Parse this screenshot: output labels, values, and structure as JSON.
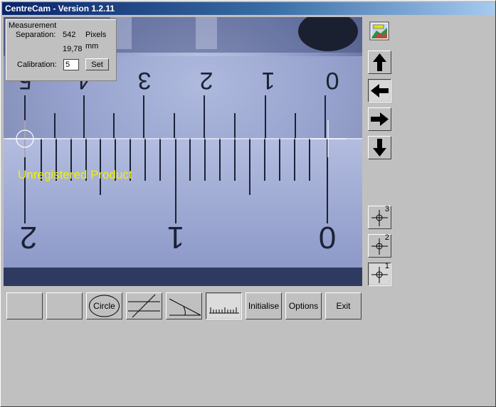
{
  "app": {
    "title": "CentreCam - Version 1.2.11"
  },
  "measurement": {
    "heading": "Measurement",
    "separation_label": "Separation:",
    "pixels_value": "542",
    "pixels_unit": "Pixels",
    "mm_value": "19,78",
    "mm_unit": "mm",
    "calibration_label": "Calibration:",
    "calibration_value": "5",
    "set_label": "Set"
  },
  "overlay": {
    "unregistered_text": "Unregistered Product"
  },
  "ruler": {
    "top_digits": [
      "5",
      "4",
      "3",
      "2",
      "1",
      "0"
    ],
    "bottom_digits": [
      "2",
      "1",
      "0"
    ]
  },
  "side_buttons": {
    "up_icon": "arrow-up-icon",
    "left_icon": "arrow-left-icon",
    "right_icon": "arrow-right-icon",
    "down_icon": "arrow-down-icon",
    "ref3": "3",
    "ref2": "2",
    "ref1": "1"
  },
  "toolbar": {
    "circle_label": "Circle",
    "initialise_label": "Initialise",
    "options_label": "Options",
    "exit_label": "Exit"
  }
}
